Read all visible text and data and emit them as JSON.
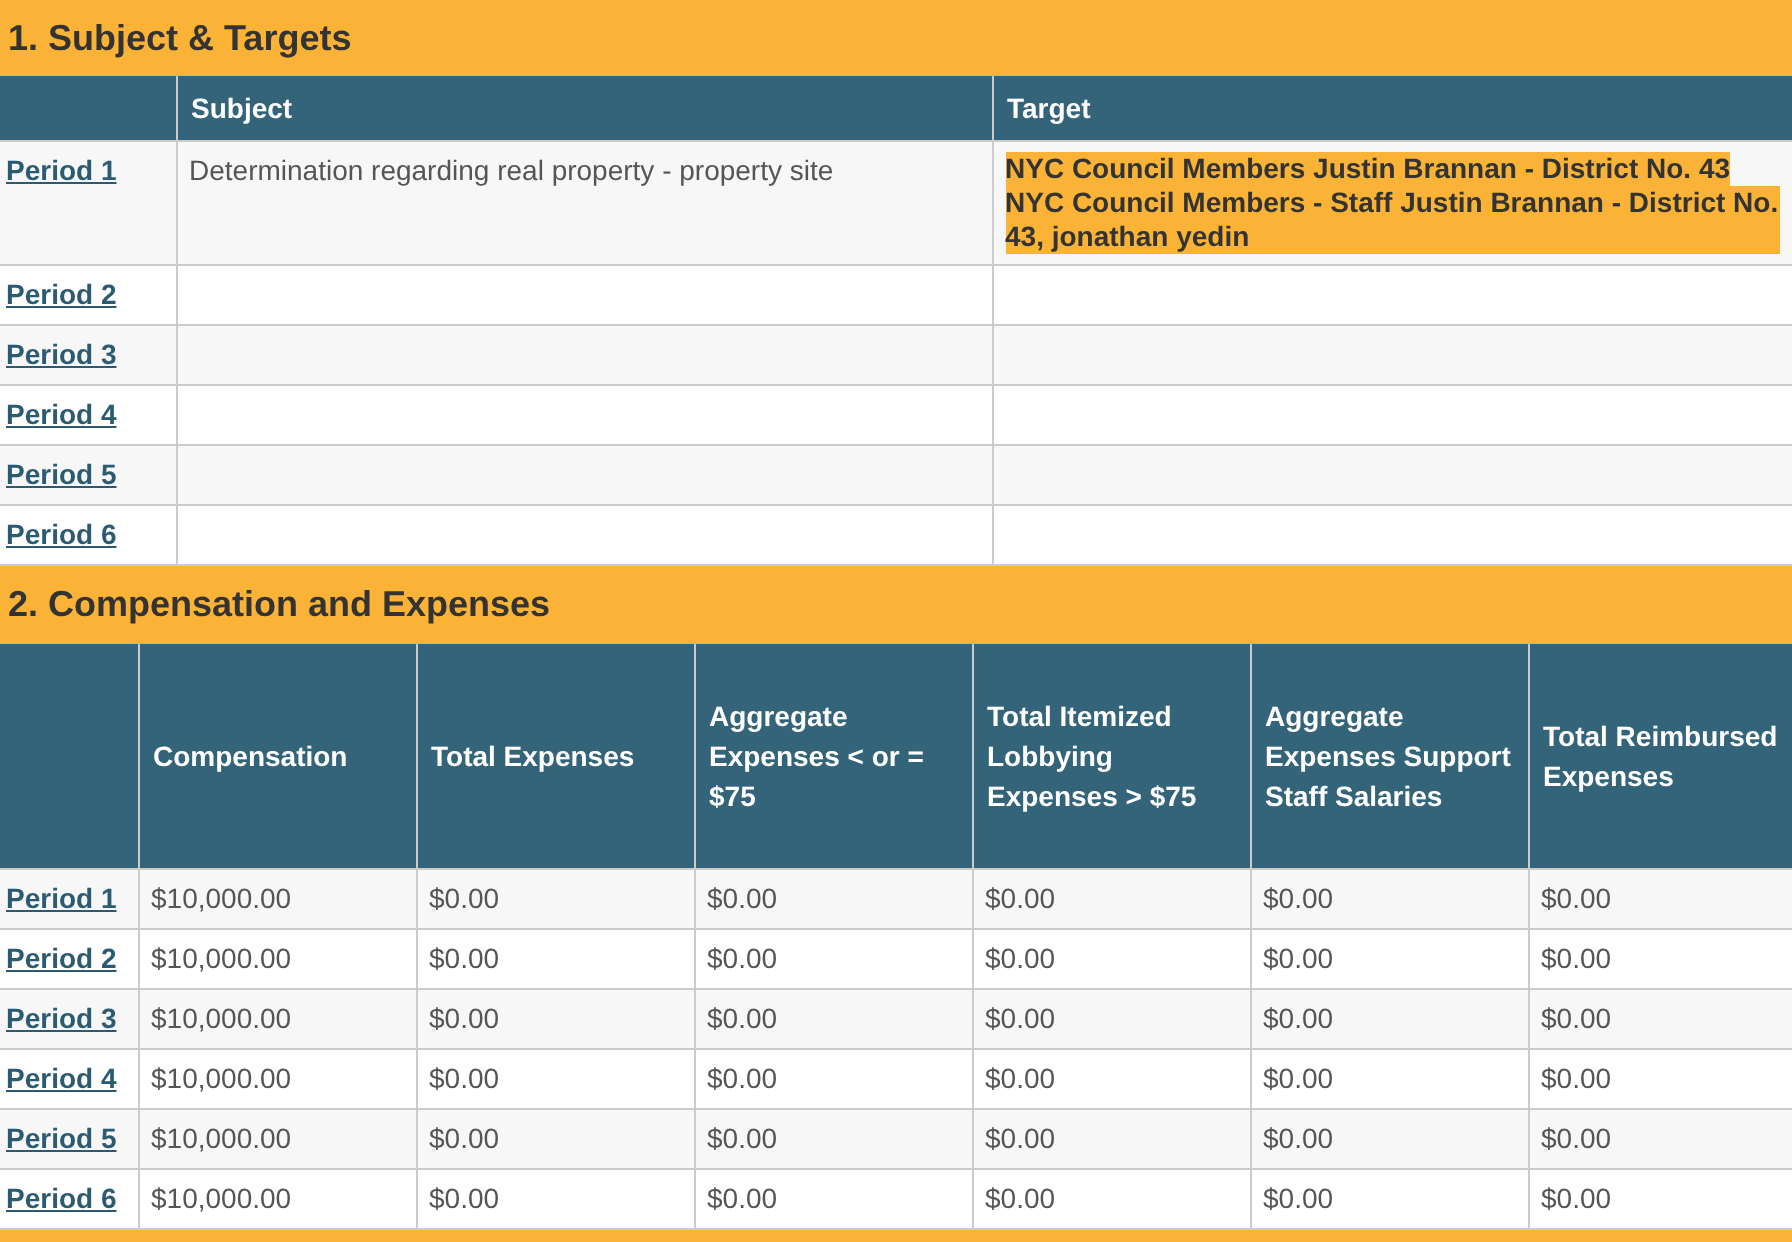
{
  "sections": [
    {
      "title": "1. Subject & Targets",
      "kind": "targets",
      "columns": [
        "",
        "Subject",
        "Target"
      ],
      "rows": [
        {
          "period": "Period 1",
          "subject": "Determination regarding real property - property site",
          "targets": [
            "NYC Council Members Justin Brannan - District No. 43",
            "NYC Council Members - Staff Justin Brannan - District No. 43, jonathan yedin"
          ]
        },
        {
          "period": "Period 2"
        },
        {
          "period": "Period 3"
        },
        {
          "period": "Period 4"
        },
        {
          "period": "Period 5"
        },
        {
          "period": "Period 6"
        }
      ]
    },
    {
      "title": "2. Compensation and Expenses",
      "kind": "expenses",
      "columns": [
        "",
        "Compensation",
        "Total Expenses",
        "Aggregate Expenses < or = $75",
        "Total Itemized Lobbying Expenses > $75",
        "Aggregate Expenses Support Staff Salaries",
        "Total Reimbursed Expenses"
      ],
      "rows": [
        {
          "period": "Period 1",
          "values": [
            "$10,000.00",
            "$0.00",
            "$0.00",
            "$0.00",
            "$0.00",
            "$0.00"
          ]
        },
        {
          "period": "Period 2",
          "values": [
            "$10,000.00",
            "$0.00",
            "$0.00",
            "$0.00",
            "$0.00",
            "$0.00"
          ]
        },
        {
          "period": "Period 3",
          "values": [
            "$10,000.00",
            "$0.00",
            "$0.00",
            "$0.00",
            "$0.00",
            "$0.00"
          ]
        },
        {
          "period": "Period 4",
          "values": [
            "$10,000.00",
            "$0.00",
            "$0.00",
            "$0.00",
            "$0.00",
            "$0.00"
          ]
        },
        {
          "period": "Period 5",
          "values": [
            "$10,000.00",
            "$0.00",
            "$0.00",
            "$0.00",
            "$0.00",
            "$0.00"
          ]
        },
        {
          "period": "Period 6",
          "values": [
            "$10,000.00",
            "$0.00",
            "$0.00",
            "$0.00",
            "$0.00",
            "$0.00"
          ]
        }
      ]
    }
  ]
}
